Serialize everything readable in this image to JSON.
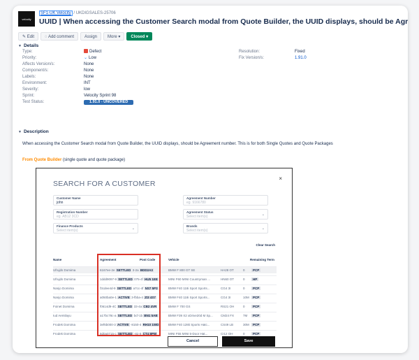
{
  "header": {
    "logo_text": "velocity",
    "project_link": "SF1-UK Velocity",
    "separator": "/",
    "issue_key": "UKDIGSALES-25706",
    "title": "UUID | When accessing the Customer Search modal from Quote Builder, the UUID displays, should be Agreement number"
  },
  "toolbar": {
    "edit": "Edit",
    "add_comment": "Add comment",
    "assign": "Assign",
    "more": "More",
    "status": "Closed"
  },
  "details": {
    "heading": "Details",
    "rows": [
      {
        "label": "Type:",
        "value": "Defect"
      },
      {
        "label": "Priority:",
        "value": "Low"
      },
      {
        "label": "Affects Version/s:",
        "value": "None"
      },
      {
        "label": "Component/s:",
        "value": "None"
      },
      {
        "label": "Labels:",
        "value": "None"
      },
      {
        "label": "Environment:",
        "value": "INT"
      },
      {
        "label": "Severity:",
        "value": "low"
      },
      {
        "label": "Sprint:",
        "value": "Velocity Sprint 98"
      },
      {
        "label": "Test Status:",
        "value": "1.91.0 - UNCOVERED"
      }
    ],
    "right": [
      {
        "label": "Resolution:",
        "value": "Fixed"
      },
      {
        "label": "Fix Version/s:",
        "value": "1.91.0"
      }
    ]
  },
  "description": {
    "heading": "Description",
    "text": "When accessing the Customer Search modal from Quote Builder, the UUID displays, should be Agreement number. This is for both Single Quotes and Quote Packages",
    "qb_label": "From Quote Builder",
    "qb_suffix": "(single quote and quote package)"
  },
  "modal": {
    "title": "SEARCH FOR A CUSTOMER",
    "close": "×",
    "fields": {
      "customer_name": {
        "label": "Customer Name",
        "value": "john"
      },
      "agreement_number": {
        "label": "Agreement Number",
        "placeholder": "eg. 9166780"
      },
      "registration_number": {
        "label": "Registration Number",
        "placeholder": "eg. AB12 3CD"
      },
      "agreement_status": {
        "label": "Agreement Status",
        "placeholder": "Select item(s)"
      },
      "finance_products": {
        "label": "Finance Products",
        "placeholder": "Select item(s)"
      },
      "brands": {
        "label": "Brands",
        "placeholder": "Select item(s)"
      }
    },
    "clear_search": "Clear Search",
    "columns": [
      "Name",
      "Agreement",
      "Post Code",
      "Vehicle",
      "Remaining Term"
    ],
    "rows": [
      {
        "name": "Ufrujds Domima",
        "agreement": "6167ee-2e",
        "status": "SETTLED",
        "agr_tail": "3-2a",
        "postcode": "BDD2A3",
        "vehicle": "BMW F 800 GT SE",
        "reg": "HA28 OT",
        "term": "0",
        "product": "PCP"
      },
      {
        "name": "Ufrujds Domima",
        "agreement": "1ddd9097-9",
        "status": "SETTLED",
        "agr_tail": "075-4f",
        "postcode": "HU5 1EE",
        "vehicle": "MINI F60 MINI Countryman ...",
        "reg": "HN60 OT",
        "term": "0",
        "product": "HP"
      },
      {
        "name": "Nanjo Domima",
        "agreement": "f3cdee4d-9",
        "status": "SETTLED",
        "agr_tail": "a7cc-4f",
        "postcode": "NS7 5P3",
        "vehicle": "BMW F40 118i Sport Sports...",
        "reg": "CG4 3I",
        "term": "0",
        "product": "PCP"
      },
      {
        "name": "Nanjo Domima",
        "agreement": "a050ba0e-1",
        "status": "ACTIVE",
        "agr_tail": "3-fbba-4",
        "postcode": "ZI3 4S7",
        "vehicle": "BMW F40 118i Sport Sports...",
        "reg": "CG4 3I",
        "term": "10M",
        "product": "PCP"
      },
      {
        "name": "Foinet Domima",
        "agreement": "f0614d9-4C",
        "status": "SETTLED",
        "agr_tail": "33-4a",
        "postcode": "CB2 4VR",
        "vehicle": "BMW F 700 GS",
        "reg": "RS21 OH",
        "term": "0",
        "product": "PCP"
      },
      {
        "name": "Iud Aemilayu",
        "agreement": "a17bc78c-a",
        "status": "SETTLED",
        "agr_tail": "bcf-1b",
        "postcode": "BN1 5AB",
        "vehicle": "BMW F39 X2 xDrive20d M Sp...",
        "reg": "CM24 FX",
        "term": "7M",
        "product": "PCP"
      },
      {
        "name": "Frodek Domima",
        "agreement": "3ef6b000-3",
        "status": "ACTIVE",
        "agr_tail": "-8150-4",
        "postcode": "RH10 1WD",
        "vehicle": "BMW F40 128ti Sports Hatc...",
        "reg": "CS49 LB",
        "term": "30M",
        "product": "PCP"
      },
      {
        "name": "Frodek Domima",
        "agreement": "8d0a0715-c",
        "status": "SETTLED",
        "agr_tail": "-82-9",
        "postcode": "CT4 8PW",
        "vehicle": "MINI F55 MINI 5-Door Hat...",
        "reg": "CI12 OH",
        "term": "0",
        "product": "PCP"
      }
    ],
    "cancel": "Cancel",
    "save": "Save"
  }
}
